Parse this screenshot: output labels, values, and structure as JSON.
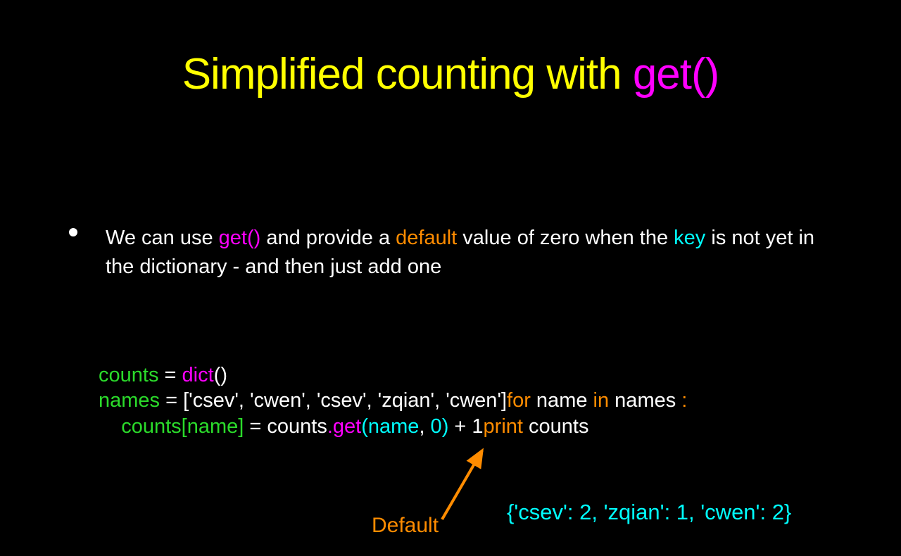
{
  "title": {
    "part1": "Simplified counting with ",
    "part2": "get()"
  },
  "bullet": {
    "p1": "We can use ",
    "p2": "get()",
    "p3": " and provide a ",
    "p4": "default",
    "p5": " value of zero when the ",
    "p6": "key",
    "p7": " is not yet in the dictionary - and then just add one"
  },
  "code": {
    "l1a": "counts",
    "l1b": " = ",
    "l1c": "dict",
    "l1d": "()",
    "l2a": "names",
    "l2b": " = ",
    "l2c": "['csev', 'cwen', 'csev', 'zqian', 'cwen']",
    "l2d": "for",
    "l2e": " name ",
    "l2f": "in",
    "l2g": " names ",
    "l2h": ":",
    "l3pad": "    ",
    "l3a": "counts[name]",
    "l3b": " = counts",
    "l3c": ".",
    "l3d": "get",
    "l3e": "(name",
    "l3f": ",",
    "l3g": " 0",
    "l3h": ")",
    "l3i": " + 1",
    "l3j": "print",
    "l3k": " counts"
  },
  "default_label": "Default",
  "output": "{'csev': 2, 'zqian': 1, 'cwen': 2}"
}
